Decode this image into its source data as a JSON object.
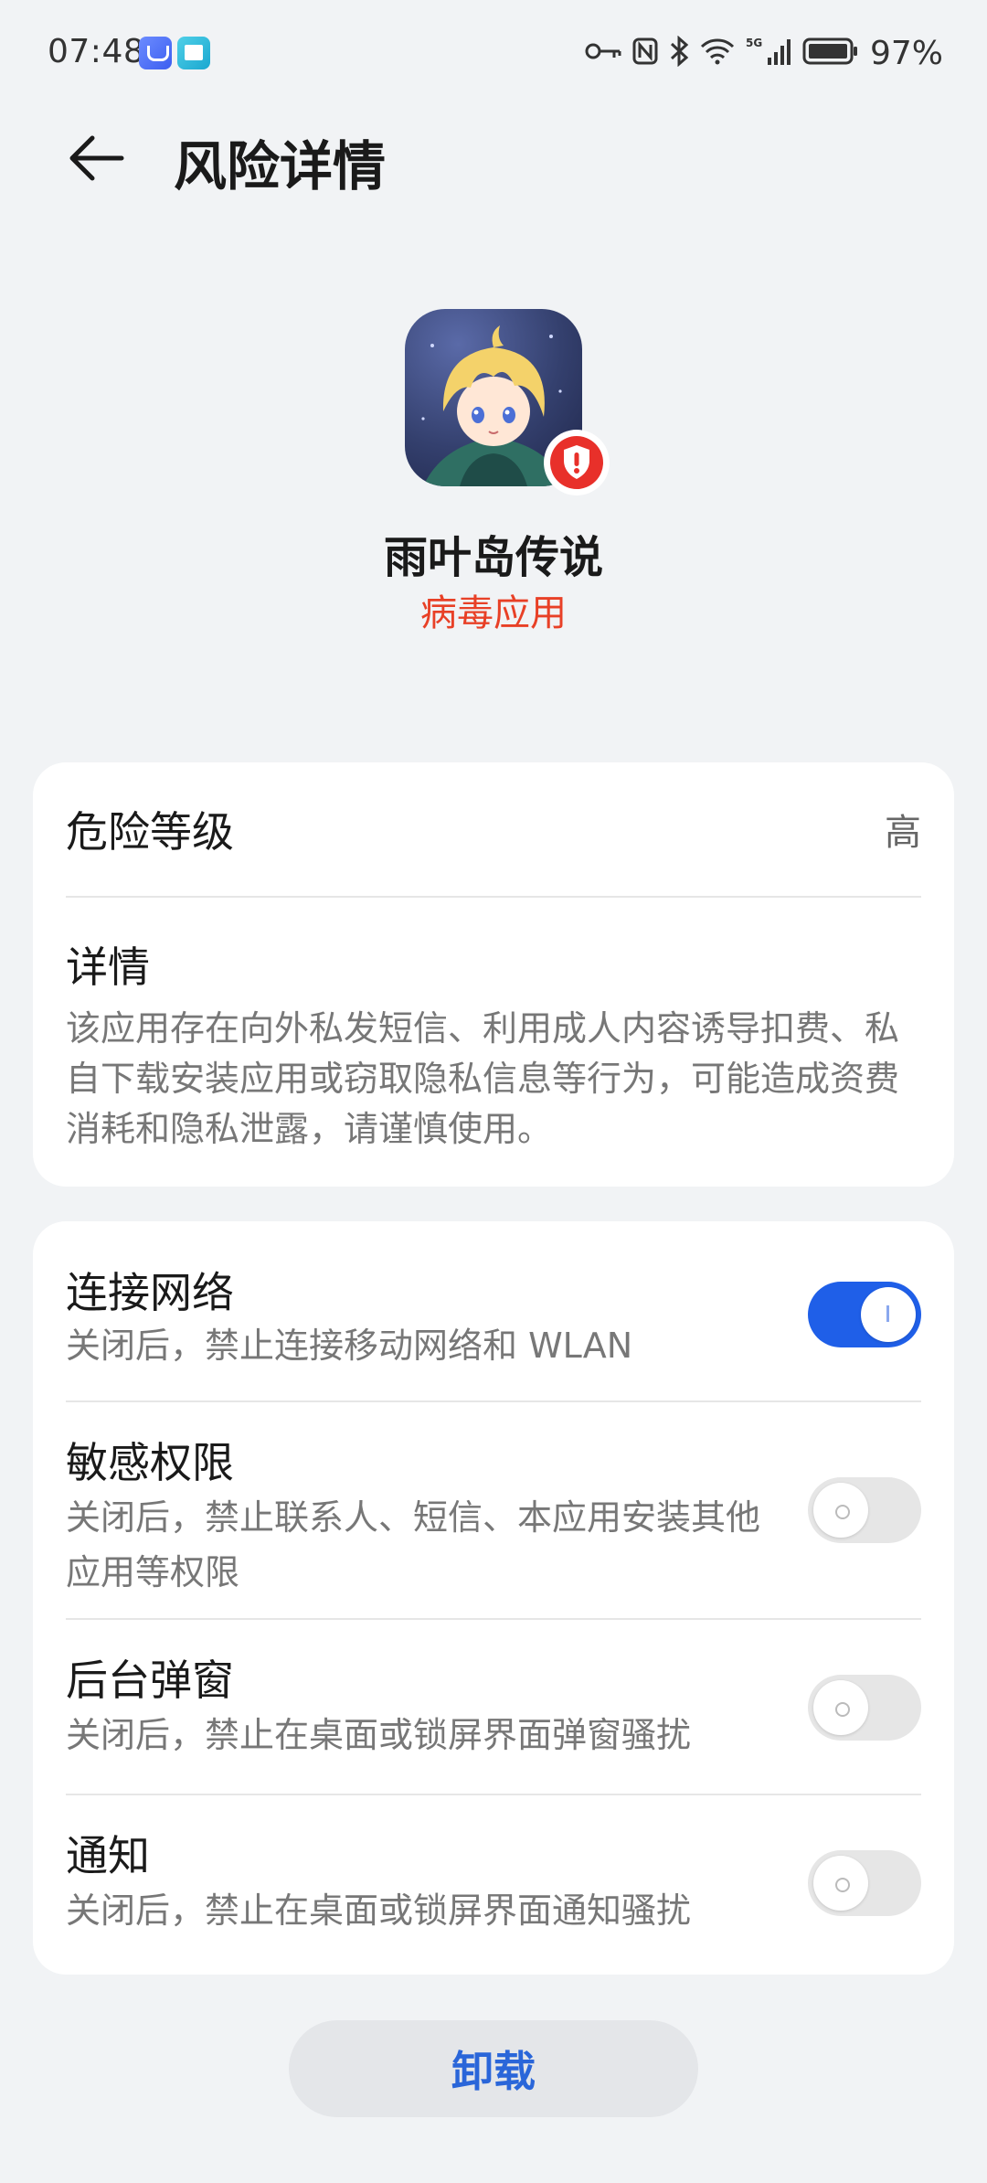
{
  "status_bar": {
    "time": "07:48",
    "battery": "97%",
    "icons": [
      "key-icon",
      "nfc-icon",
      "bluetooth-icon",
      "wifi-icon",
      "5g-signal-icon",
      "battery-icon"
    ]
  },
  "header": {
    "title": "风险详情",
    "back_icon": "arrow-left-icon"
  },
  "app": {
    "name": "雨叶岛传说",
    "risk_type": "病毒应用",
    "badge_icon": "shield-alert-icon"
  },
  "risk_card": {
    "level_label": "危险等级",
    "level_value": "高",
    "details_title": "详情",
    "details_text": "该应用存在向外私发短信、利用成人内容诱导扣费、私自下载安装应用或窃取隐私信息等行为，可能造成资费消耗和隐私泄露，请谨慎使用。"
  },
  "permissions": [
    {
      "title": "连接网络",
      "desc": "关闭后，禁止连接移动网络和 WLAN",
      "enabled": true
    },
    {
      "title": "敏感权限",
      "desc": "关闭后，禁止联系人、短信、本应用安装其他应用等权限",
      "enabled": false
    },
    {
      "title": "后台弹窗",
      "desc": "关闭后，禁止在桌面或锁屏界面弹窗骚扰",
      "enabled": false
    },
    {
      "title": "通知",
      "desc": "关闭后，禁止在桌面或锁屏界面通知骚扰",
      "enabled": false
    }
  ],
  "actions": {
    "uninstall_label": "卸载"
  },
  "colors": {
    "accent": "#1f5fe8",
    "danger": "#e84026",
    "background": "#f1f3f5"
  }
}
